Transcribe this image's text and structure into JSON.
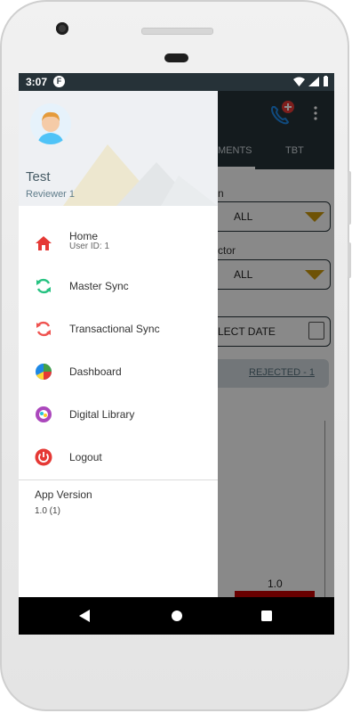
{
  "status_bar": {
    "time": "3:07",
    "notification_icon": "F"
  },
  "background_app": {
    "tabs": [
      "MENTS",
      "TBT"
    ],
    "labels": [
      "n",
      "ctor"
    ],
    "dropdowns": [
      {
        "value": "ALL"
      },
      {
        "value": "ALL"
      }
    ],
    "date_field": {
      "value": "ELECT DATE"
    },
    "rejected_tab": "REJECTED - 1",
    "chart_value_label": "1.0",
    "bar_color": "#c00000"
  },
  "drawer": {
    "user": {
      "name": "Test",
      "role": "Reviewer 1"
    },
    "items": [
      {
        "label": "Home",
        "sub": "User ID: 1",
        "icon": "home-icon"
      },
      {
        "label": "Master Sync",
        "icon": "sync-icon"
      },
      {
        "label": "Transactional Sync",
        "icon": "transactional-sync-icon"
      },
      {
        "label": "Dashboard",
        "icon": "pie-chart-icon"
      },
      {
        "label": "Digital Library",
        "icon": "library-icon"
      },
      {
        "label": "Logout",
        "icon": "power-icon"
      }
    ],
    "app_version": {
      "label": "App Version",
      "value": "1.0 (1)"
    }
  },
  "nav_bar": {
    "back": "back-icon",
    "home": "home-circle-icon",
    "recents": "recents-icon"
  },
  "colors": {
    "app_bar": "#263238",
    "accent": "#c8950a",
    "logout_red": "#e53935"
  }
}
